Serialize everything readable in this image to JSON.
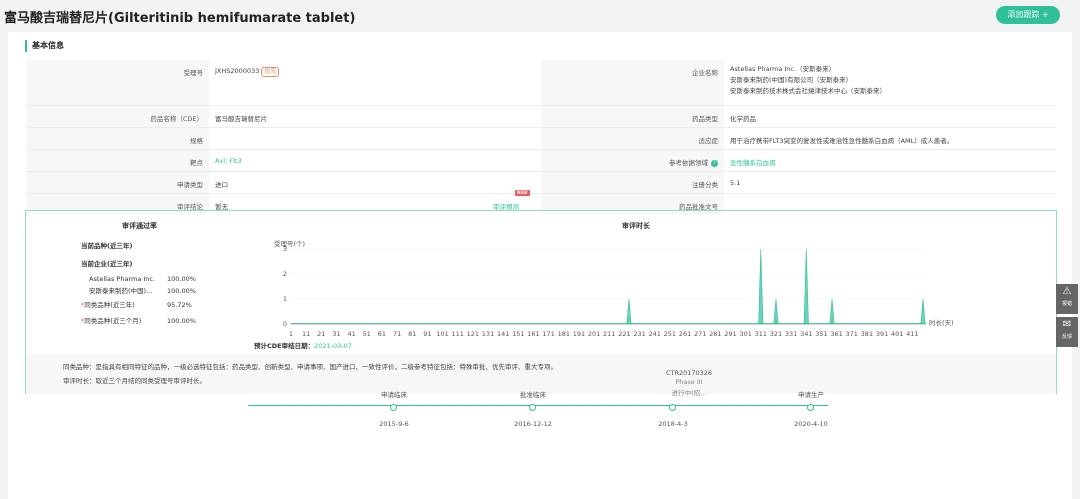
{
  "header": {
    "title": "富马酸吉瑞替尼片(Gilteritinib hemifumarate tablet)",
    "add_button": "添加跟踪 +"
  },
  "section": {
    "title": "基本信息"
  },
  "info": {
    "accept_no_label": "受理号",
    "accept_no": "JXHS2000033",
    "priority_tag": "优先",
    "company_label": "企业名称",
    "company_lines": [
      "Astellas Pharma Inc.（安斯泰来）",
      "安斯泰来制药(中国)有限公司（安斯泰来）",
      "安斯泰来制药技术株式会社燒津技术中心（安斯泰来）"
    ],
    "drug_name_label": "药品名称（CDE）",
    "drug_name": "富马酸吉瑞替尼片",
    "drug_type_label": "药品类型",
    "drug_type": "化学药品",
    "spec_label": "规格",
    "spec": "",
    "indication_label": "适应症",
    "indication": "用于治疗携带FLT3突变的复发性或难治性急性髓系白血病（AML）成人患者。",
    "target_label": "靶点",
    "target": "Axl; Flt3",
    "ref_label": "参考依据领域",
    "ref_value": "急性髓系白血病",
    "apply_type_label": "申请类型",
    "apply_type": "进口",
    "reg_class_label": "注册分类",
    "reg_class": "5.1",
    "conclusion_label": "审评结论",
    "conclusion": "暂无",
    "predict_link": "审评预测",
    "new_badge": "NEW",
    "approval_no_label": "药品批准文号",
    "approval_no": ""
  },
  "review": {
    "pass_rate_title": "审评通过率",
    "time_title": "审评时长",
    "current_variety": "当前品种(近三年)",
    "current_company": "当前企业(近三年)",
    "companies": [
      {
        "name": "Astellas Pharma Inc.",
        "rate": "100.00%"
      },
      {
        "name": "安斯泰来制药(中国)...",
        "rate": "100.00%"
      }
    ],
    "same_3y_label": "同类品种(近三年)",
    "same_3y_rate": "95.72%",
    "same_3m_label": "同类品种(近三个月)",
    "same_3m_rate": "100.00%",
    "est_label": "预计CDE审结日期：",
    "est_date": "2021-03-07",
    "footer_line1": "同类品种：是指具有相同特征的品种，一级必选特征包括：药品类型、创新类型、申请事项、国产进口、一致性评价，二级参考特征包括：特殊审批、优先审评、重大专项。",
    "footer_line2": "审评时长：取近三个月结的同类受理号审评时长。"
  },
  "chart_data": {
    "type": "area",
    "ylabel": "受理号(个)",
    "xlabel": "时长(天)",
    "ylim": [
      0,
      3
    ],
    "yticks": [
      0,
      1,
      2,
      3
    ],
    "xlim": [
      1,
      420
    ],
    "xticks": [
      1,
      11,
      21,
      31,
      41,
      51,
      61,
      71,
      81,
      91,
      101,
      111,
      121,
      131,
      141,
      151,
      161,
      171,
      181,
      191,
      201,
      211,
      221,
      231,
      241,
      251,
      261,
      271,
      281,
      291,
      301,
      311,
      321,
      331,
      341,
      351,
      361,
      371,
      381,
      391,
      401,
      411
    ],
    "points": [
      {
        "x": 224,
        "y": 1
      },
      {
        "x": 311,
        "y": 3
      },
      {
        "x": 321,
        "y": 1
      },
      {
        "x": 341,
        "y": 3
      },
      {
        "x": 358,
        "y": 1
      },
      {
        "x": 418,
        "y": 1
      }
    ],
    "color": "#2fbf99"
  },
  "timeline": {
    "top_link": "CTR20170326",
    "phase": "Phase III",
    "status": "进行中(招...",
    "nodes": [
      {
        "label": "申请临床",
        "date": "2015-9-6"
      },
      {
        "label": "批准临床",
        "date": "2016-12-12"
      },
      {
        "label": "",
        "date": "2018-4-3"
      },
      {
        "label": "申请生产",
        "date": "2020-4-10"
      }
    ]
  },
  "side_tools": [
    {
      "icon": "warning-icon",
      "label": "报错"
    },
    {
      "icon": "feedback-icon",
      "label": "反馈"
    }
  ]
}
